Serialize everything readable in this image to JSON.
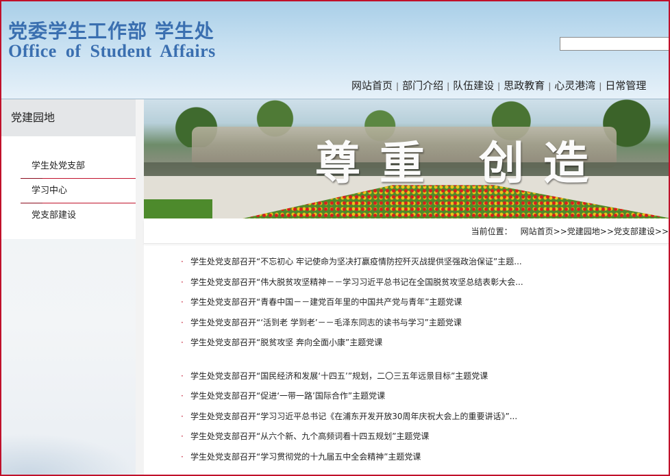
{
  "header": {
    "logo_cn": "党委学生工作部  学生处",
    "logo_en": "Office of Student Affairs",
    "search_placeholder": ""
  },
  "nav": {
    "items": [
      "网站首页",
      "部门介绍",
      "队伍建设",
      "思政教育",
      "心灵港湾",
      "日常管理"
    ]
  },
  "sidebar": {
    "title": "党建园地",
    "items": [
      "学生处党支部",
      "学习中心",
      "党支部建设"
    ]
  },
  "banner": {
    "text": "尊重 创造"
  },
  "breadcrumb": {
    "label": "当前位置：",
    "crumbs": [
      "网站首页",
      ">>",
      "党建园地",
      ">>",
      "党支部建设",
      ">>"
    ]
  },
  "news": [
    "学生处党支部召开“不忘初心 牢记使命为坚决打赢疫情防控歼灭战提供坚强政治保证”主题...",
    "学生处党支部召开“伟大脱贫攻坚精神－－学习习近平总书记在全国脱贫攻坚总结表彰大会...",
    "学生处党支部召开“青春中国－－建党百年里的中国共产党与青年”主题党课",
    "学生处党支部召开“‘活到老 学到老’－－毛泽东同志的读书与学习”主题党课",
    "学生处党支部召开“脱贫攻坚 奔向全面小康”主题党课",
    "学生处党支部召开“国民经济和发展‘十四五’”规划，二〇三五年远景目标”主题党课",
    "学生处党支部召开“促进‘一带一路’国际合作”主题党课",
    "学生处党支部召开“学习习近平总书记《在浦东开发开放30周年庆祝大会上的重要讲话》”...",
    "学生处党支部召开“从六个新、九个高频词看十四五规划”主题党课",
    "学生处党支部召开“学习贯彻党的十九届五中全会精神”主题党课"
  ],
  "colors": {
    "accent": "#c0102a",
    "logo": "#3a6fb0"
  }
}
